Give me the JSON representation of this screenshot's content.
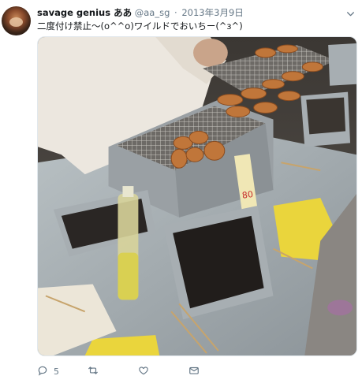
{
  "tweet": {
    "display_name": "savage genius ああ",
    "handle": "@aa_sg",
    "separator": "·",
    "timestamp": "2013年3月9日",
    "text": "二度付け禁止～(o^^o)ワイルドでおいちー(^з^)",
    "photo": {
      "description_icon": "photo-kushikatsu-counter",
      "sign_text": "80"
    },
    "actions": {
      "reply_count": "5",
      "retweet_count": "",
      "like_count": "",
      "icons": [
        "reply-icon",
        "retweet-icon",
        "like-icon",
        "direct-message-icon"
      ]
    }
  },
  "colors": {
    "text_primary": "#14171a",
    "text_secondary": "#657786",
    "border": "#e1e8ed",
    "icon": "#657786"
  }
}
